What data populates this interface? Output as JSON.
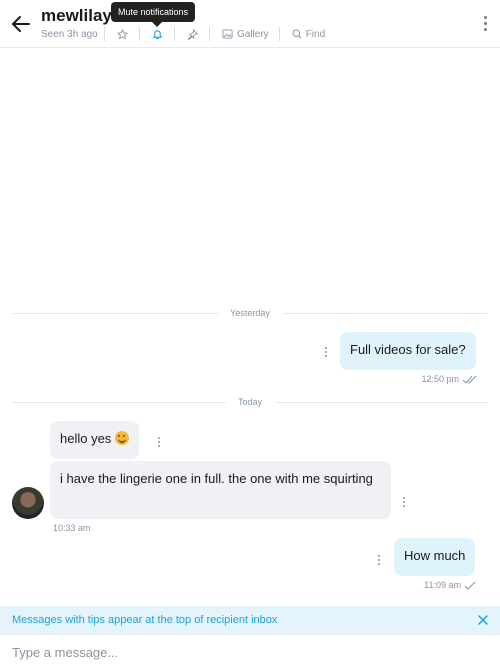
{
  "header": {
    "title": "mewlilay",
    "seen": "Seen 3h ago",
    "tooltip": "Mute notifications",
    "actions": {
      "gallery": "Gallery",
      "find": "Find"
    }
  },
  "messages": [
    {
      "divider": "Yesterday"
    },
    {
      "direction": "out",
      "text": "Full videos for sale?",
      "time": "12:50 pm",
      "status": "read"
    },
    {
      "divider": "Today"
    },
    {
      "direction": "in",
      "text": "hello yes",
      "emoji": "grinning-face-icon"
    },
    {
      "direction": "in",
      "text": "i have the lingerie one in full. the one with me squirting",
      "time": "10:33 am"
    },
    {
      "direction": "out",
      "text": "How much",
      "time": "11:09 am",
      "status": "sent"
    }
  ],
  "banner": {
    "text": "Messages with tips appear at the top of recipient inbox"
  },
  "composer": {
    "placeholder": "Type a message..."
  },
  "colors": {
    "accent": "#1aa3e0",
    "out_bubble": "#dff3fd",
    "in_bubble": "#f0f1f4",
    "muted": "#8a96a3"
  }
}
